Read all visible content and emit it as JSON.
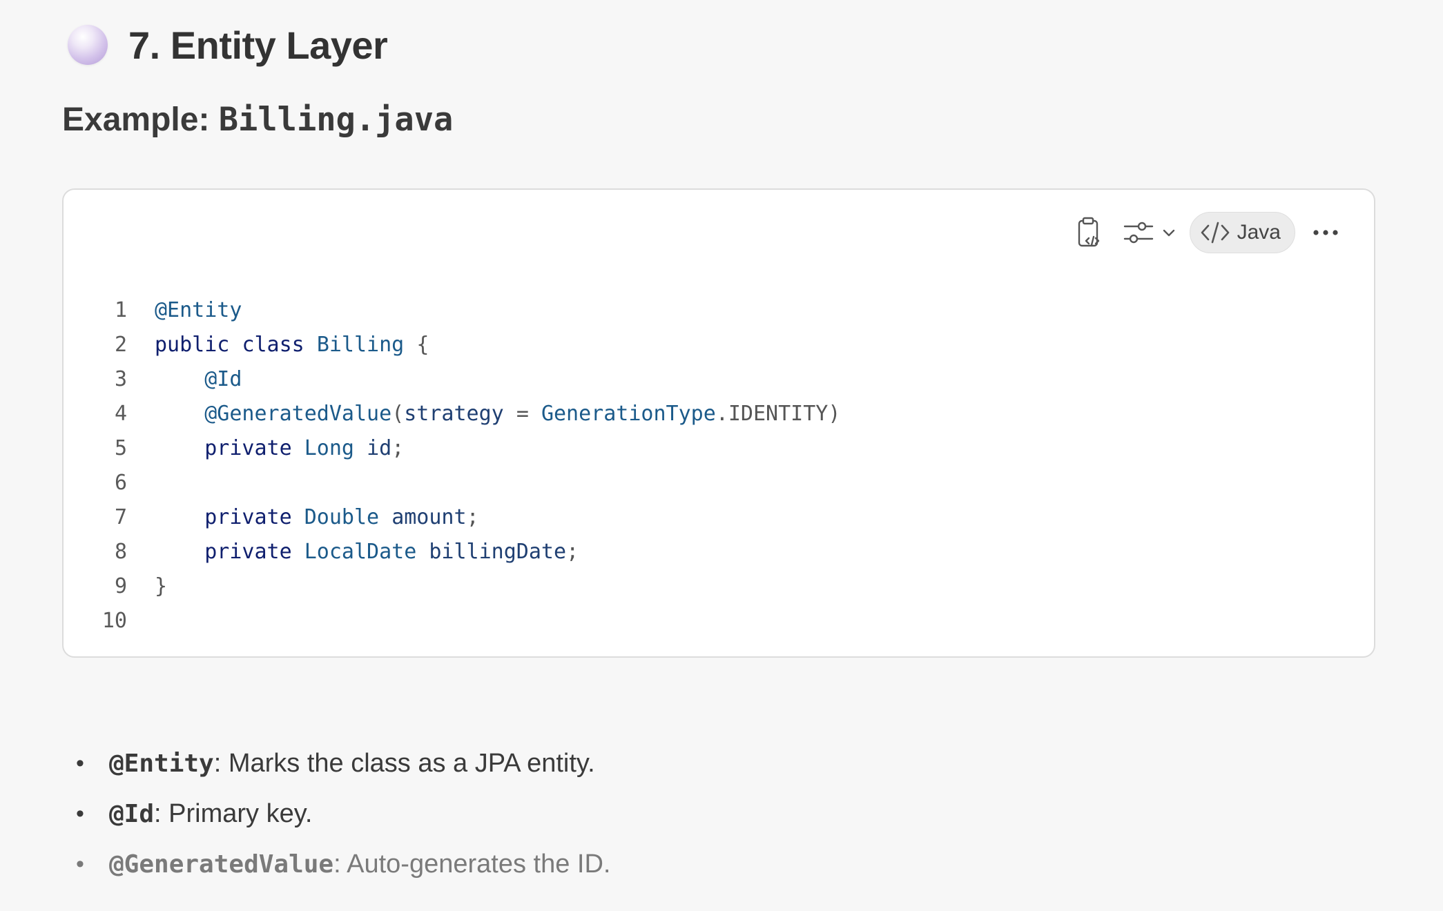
{
  "section": {
    "title": "7. Entity Layer"
  },
  "subheading": {
    "prefix": "Example: ",
    "filename": "Billing.java"
  },
  "code_block": {
    "language": "Java",
    "lines": [
      {
        "num": "1"
      },
      {
        "num": "2"
      },
      {
        "num": "3"
      },
      {
        "num": "4"
      },
      {
        "num": "5"
      },
      {
        "num": "6"
      },
      {
        "num": "7"
      },
      {
        "num": "8"
      },
      {
        "num": "9"
      },
      {
        "num": "10"
      }
    ],
    "tokens": {
      "l1_entity": "@Entity",
      "l2_public": "public",
      "l2_class": "class",
      "l2_name": "Billing",
      "l2_brace": "{",
      "l3_id": "@Id",
      "l4_gen": "@GeneratedValue",
      "l4_open": "(",
      "l4_strategy": "strategy",
      "l4_eq": "=",
      "l4_type": "GenerationType",
      "l4_dot": ".",
      "l4_identity": "IDENTITY",
      "l4_close": ")",
      "l5_private": "private",
      "l5_type": "Long",
      "l5_name": "id",
      "l5_semi": ";",
      "l7_private": "private",
      "l7_type": "Double",
      "l7_name": "amount",
      "l7_semi": ";",
      "l8_private": "private",
      "l8_type": "LocalDate",
      "l8_name": "billingDate",
      "l8_semi": ";",
      "l9_brace": "}"
    }
  },
  "bullets": [
    {
      "code": "@Entity",
      "text": ": Marks the class as a JPA entity."
    },
    {
      "code": "@Id",
      "text": ": Primary key."
    },
    {
      "code": "@GeneratedValue",
      "text": ": Auto-generates the ID."
    }
  ],
  "icons": {
    "section": "sphere-icon",
    "copy": "clipboard-code-icon",
    "settings": "sliders-icon",
    "dropdown": "chevron-down-icon",
    "language": "code-brackets-icon",
    "more": "more-horizontal-icon",
    "bullet": "bullet-dot-icon"
  },
  "bullet_glyph": "•"
}
